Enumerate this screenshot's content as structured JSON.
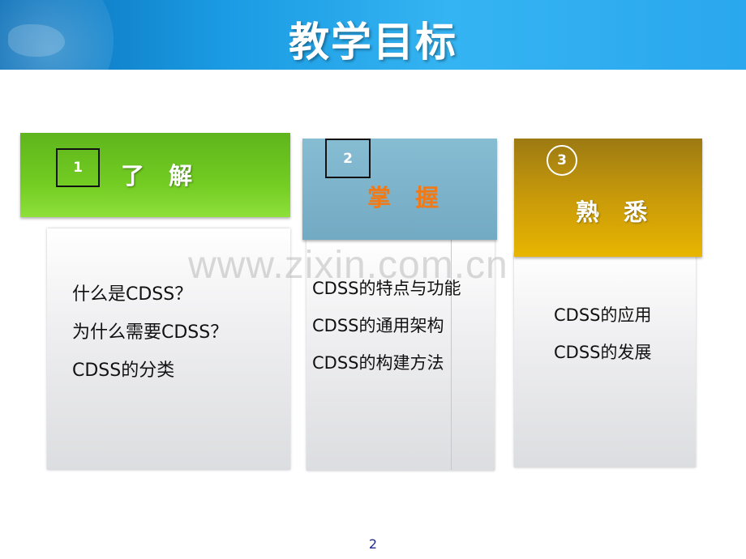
{
  "header": {
    "title": "教学目标"
  },
  "cards": [
    {
      "number": "1",
      "label": "了 解",
      "items": [
        "什么是CDSS？",
        "为什么需要CDSS？",
        "CDSS的分类"
      ]
    },
    {
      "number": "2",
      "label": "掌 握",
      "items": [
        "CDSS的特点与功能",
        "CDSS的通用架构",
        "CDSS的构建方法"
      ]
    },
    {
      "number": "3",
      "label": "熟 悉",
      "items": [
        "CDSS的应用",
        "CDSS的发展"
      ]
    }
  ],
  "watermark": "www.zixin.com.cn",
  "footer": {
    "page_number": "2"
  },
  "colors": {
    "banner": "#1a9be3",
    "card1_head": "#6cc41e",
    "card2_head": "#7eb4cb",
    "card3_head": "#d9a300",
    "card2_label": "#f07a17"
  }
}
